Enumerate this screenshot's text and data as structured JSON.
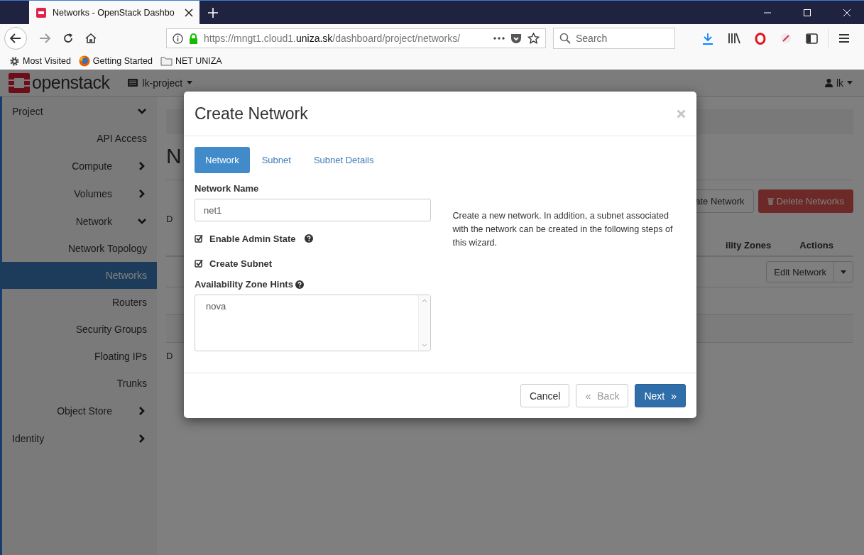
{
  "browser": {
    "tabs": [
      {
        "title": "Networks - OpenStack Dashbo",
        "selected": true
      }
    ],
    "url": {
      "prefix": "https://mngt1.cloud1.",
      "domain": "uniza.sk",
      "path": "/dashboard/project/networks/"
    },
    "search": {
      "placeholder": "Search"
    },
    "bookmarks": [
      {
        "label": "Most Visited",
        "kind": "gear"
      },
      {
        "label": "Getting Started",
        "kind": "globe"
      },
      {
        "label": "NET UNIZA",
        "kind": "folder"
      }
    ]
  },
  "header": {
    "logo": "openstack",
    "project": "lk-project",
    "user": "lk"
  },
  "sidebar": {
    "items": [
      {
        "label": "Project",
        "expanded": true,
        "children": [
          {
            "label": "API Access"
          },
          {
            "label": "Compute",
            "expanded": false
          },
          {
            "label": "Volumes",
            "expanded": false
          },
          {
            "label": "Network",
            "expanded": true,
            "children": [
              {
                "label": "Network Topology",
                "selected": false
              },
              {
                "label": "Networks",
                "selected": true
              },
              {
                "label": "Routers",
                "selected": false
              },
              {
                "label": "Security Groups",
                "selected": false
              },
              {
                "label": "Floating IPs",
                "selected": false
              },
              {
                "label": "Trunks",
                "selected": false
              }
            ]
          },
          {
            "label": "Object Store",
            "expanded": false
          }
        ]
      },
      {
        "label": "Identity",
        "expanded": false
      }
    ]
  },
  "main": {
    "title": "N",
    "filter_fragment": "D",
    "create_fragment": "ate Network",
    "delete_button": "Delete Networks",
    "column_fragment": "ility Zones",
    "actions_column": "Actions",
    "row_action": "Edit Network",
    "footer_fragment": "D"
  },
  "modal": {
    "title": "Create Network",
    "tabs": [
      {
        "label": "Network",
        "selected": true
      },
      {
        "label": "Subnet",
        "selected": false
      },
      {
        "label": "Subnet Details",
        "selected": false
      }
    ],
    "network_name": {
      "label": "Network Name",
      "value": "net1"
    },
    "checkboxes": [
      {
        "label": "Enable Admin State",
        "checked": true,
        "help": true
      },
      {
        "label": "Create Subnet",
        "checked": true,
        "help": false
      }
    ],
    "zone_hints": {
      "label": "Availability Zone Hints",
      "options": [
        "nova"
      ]
    },
    "description": "Create a new network. In addition, a subnet associated with the network can be created in the following steps of this wizard.",
    "buttons": {
      "cancel": "Cancel",
      "back": "Back",
      "back_icon": "«",
      "next": "Next",
      "next_icon": "»"
    }
  }
}
